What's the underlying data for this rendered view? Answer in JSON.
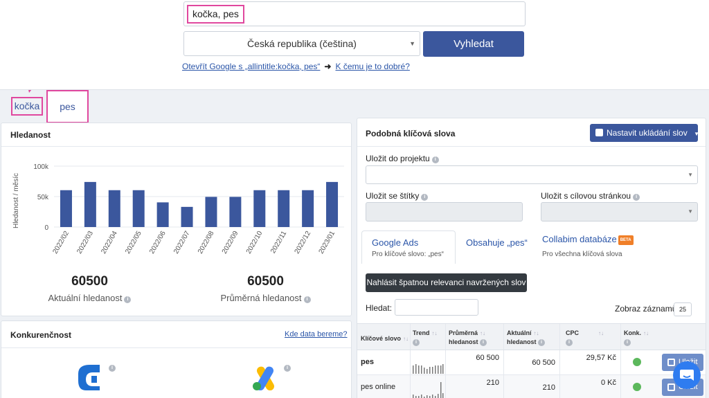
{
  "search": {
    "keywords": "kočka, pes",
    "country": "Česká republika (čeština)",
    "button": "Vyhledat",
    "google_link": "Otevřít Google s „allintitle:kočka, pes“",
    "help_link": "K čemu je to dobré?"
  },
  "tabs": [
    {
      "label": "kočka"
    },
    {
      "label": "pes"
    }
  ],
  "hledanost": {
    "title": "Hledanost",
    "current_value": "60500",
    "current_label": "Aktuální hledanost",
    "average_value": "60500",
    "average_label": "Průměrná hledanost"
  },
  "chart_data": {
    "type": "bar",
    "ylabel": "Hledanost / měsíc",
    "categories": [
      "2022/02",
      "2022/03",
      "2022/04",
      "2022/05",
      "2022/06",
      "2022/07",
      "2022/08",
      "2022/09",
      "2022/10",
      "2022/11",
      "2022/12",
      "2023/01"
    ],
    "values": [
      60500,
      74000,
      60500,
      60500,
      40500,
      33100,
      49500,
      49500,
      60500,
      60500,
      60500,
      74000
    ],
    "yticks": [
      "0",
      "50k",
      "100k"
    ],
    "ylim": [
      0,
      100000
    ],
    "bar_color": "#3b579d"
  },
  "konkurence": {
    "title": "Konkurenčnost",
    "link": "Kde data bereme?"
  },
  "similar": {
    "title": "Podobná klíčová slova",
    "settings_button": "Nastavit ukládání slov",
    "project_label": "Uložit do projektu",
    "tags_label": "Uložit se štítky",
    "landing_label": "Uložit s cílovou stránkou",
    "source_tabs": [
      {
        "label": "Google Ads",
        "sub": "Pro klíčové slovo: „pes“"
      },
      {
        "label": "Obsahuje „pes“",
        "sub": ""
      },
      {
        "label": "Collabim databáze",
        "sub": "Pro všechna klíčová slova",
        "badge": "BETA"
      }
    ],
    "report_button": "Nahlásit špatnou relevanci navržených slov",
    "search_label": "Hledat:",
    "per_page_label": "Zobraz záznamů",
    "per_page_value": "25",
    "columns": {
      "keyword": "Klíčové slovo",
      "trend": "Trend",
      "avg_l1": "Průměrná",
      "avg_l2": "hledanost",
      "cur_l1": "Aktuální",
      "cur_l2": "hledanost",
      "cpc": "CPC",
      "konk": "Konk."
    },
    "rows": [
      {
        "keyword": "pes",
        "average": "60 500",
        "current": "60 500",
        "cpc": "29,57 Kč",
        "save": "Uložit"
      },
      {
        "keyword": "pes online",
        "average": "210",
        "current": "210",
        "cpc": "0 Kč",
        "save": "Uložit"
      }
    ]
  },
  "colors": {
    "brand": "#3b579d",
    "annotation": "#e0479e",
    "link": "#2a55a8"
  }
}
